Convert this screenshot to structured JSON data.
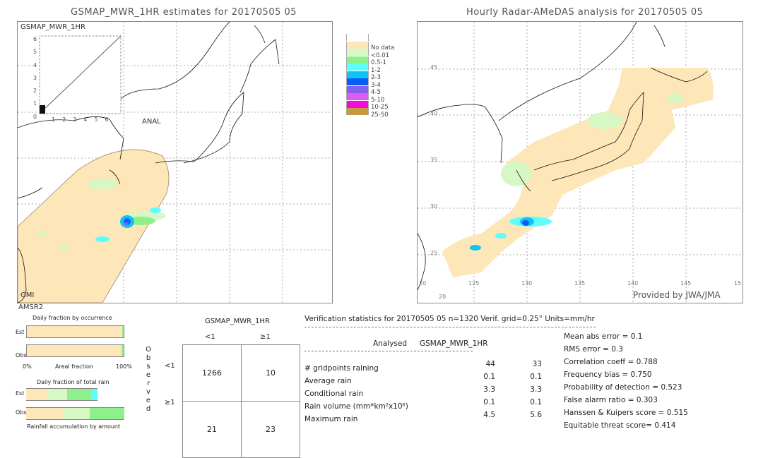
{
  "left_panel": {
    "title": "GSMAP_MWR_1HR estimates for 20170505 05",
    "scatter": {
      "ylabel": "GSMAP_MWR_1HR",
      "xlabel": "ANAL",
      "x_ticks": [
        "1",
        "2",
        "3",
        "4",
        "5",
        "6"
      ],
      "y_ticks": [
        "0",
        "1",
        "2",
        "3",
        "4",
        "5",
        "6"
      ]
    },
    "sensor_labels": [
      "GMI",
      "AMSR2"
    ]
  },
  "legend": {
    "items": [
      {
        "label": "",
        "color": "#ffffff"
      },
      {
        "label": "No data",
        "color": "#fde6b8"
      },
      {
        "label": "<0.01",
        "color": "#d7f7c4"
      },
      {
        "label": "0.5-1",
        "color": "#8ef08a"
      },
      {
        "label": "1-2",
        "color": "#5ffdfd"
      },
      {
        "label": "2-3",
        "color": "#10c3f4"
      },
      {
        "label": "3-4",
        "color": "#0a5ef6"
      },
      {
        "label": "4-5",
        "color": "#8460f2"
      },
      {
        "label": "5-10",
        "color": "#dc5cf2"
      },
      {
        "label": "10-25",
        "color": "#f20cdc"
      },
      {
        "label": "25-50",
        "color": "#c89a40"
      }
    ]
  },
  "right_panel": {
    "title": "Hourly Radar-AMeDAS analysis for 20170505 05",
    "lat_labels": [
      "45",
      "40",
      "35",
      "30",
      "25",
      "20"
    ],
    "lon_labels": [
      "20",
      "125",
      "130",
      "135",
      "140",
      "145",
      "15"
    ],
    "credit": "Provided by JWA/JMA"
  },
  "occurrence_chart": {
    "title": "Daily fraction by occurrence",
    "rows": [
      "Est",
      "Obs"
    ],
    "axis_left": "0%",
    "axis_mid": "Areal fraction",
    "axis_right": "100%",
    "est_fractions": {
      "no_rain": 0.985,
      "light": 0.015
    },
    "obs_fractions": {
      "no_rain": 0.975,
      "light": 0.025
    }
  },
  "total_rain_chart": {
    "title": "Daily fraction of total rain",
    "rows": [
      "Est",
      "Obs"
    ],
    "footer": "Rainfall accumulation by amount",
    "est_segments": [
      {
        "category": "No data",
        "fraction": 0.22
      },
      {
        "category": "<0.01",
        "fraction": 0.2
      },
      {
        "category": "0.5-1",
        "fraction": 0.24
      },
      {
        "category": "1-2",
        "fraction": 0.07
      }
    ],
    "obs_segments": [
      {
        "category": "No data",
        "fraction": 0.39
      },
      {
        "category": "<0.01",
        "fraction": 0.26
      },
      {
        "category": "0.5-1",
        "fraction": 0.35
      }
    ]
  },
  "contingency": {
    "header": "GSMAP_MWR_1HR",
    "col_labels": [
      "<1",
      "≥1"
    ],
    "row_axis_label": "Observed",
    "row_labels": [
      "<1",
      "≥1"
    ],
    "cells": [
      [
        "1266",
        "10"
      ],
      [
        "21",
        "23"
      ]
    ]
  },
  "verification": {
    "header": "Verification statistics for 20170505 05   n=1320   Verif. grid=0.25°   Units=mm/hr",
    "col_analysed": "Analysed",
    "col_estimate": "GSMAP_MWR_1HR",
    "rows": [
      {
        "label": "# gridpoints raining",
        "analysed": "44",
        "estimate": "33"
      },
      {
        "label": "Average rain",
        "analysed": "0.1",
        "estimate": "0.1"
      },
      {
        "label": "Conditional rain",
        "analysed": "3.3",
        "estimate": "3.3"
      },
      {
        "label": "Rain volume (mm*km²x10⁶)",
        "analysed": "0.1",
        "estimate": "0.1"
      },
      {
        "label": "Maximum rain",
        "analysed": "4.5",
        "estimate": "5.6"
      }
    ],
    "scores": [
      "Mean abs error = 0.1",
      "RMS error = 0.3",
      "Correlation coeff = 0.788",
      "Frequency bias = 0.750",
      "Probability of detection = 0.523",
      "False alarm ratio = 0.303",
      "Hanssen & Kuipers score = 0.515",
      "Equitable threat score= 0.414"
    ]
  }
}
